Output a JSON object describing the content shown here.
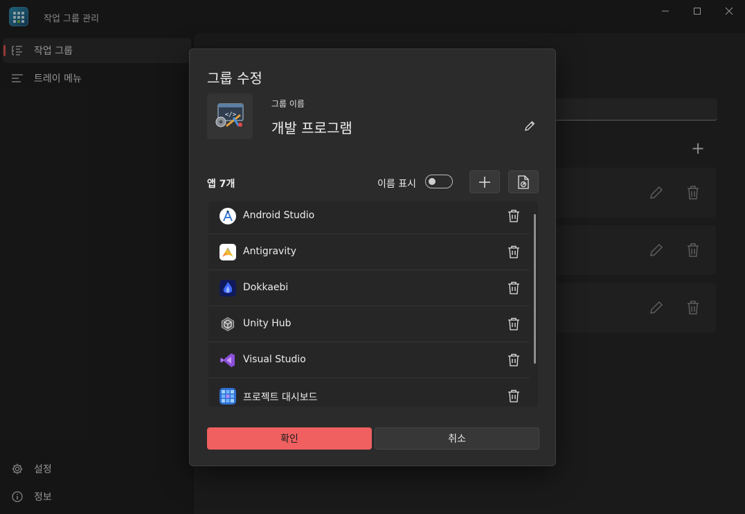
{
  "window": {
    "title": "작업 그룹 관리",
    "minimize_icon": "minimize-icon",
    "maximize_icon": "maximize-icon",
    "close_icon": "close-icon"
  },
  "sidebar": {
    "items": [
      {
        "label": "작업 그룹",
        "icon": "list-icon",
        "active": true
      },
      {
        "label": "트레이 메뉴",
        "icon": "menu-lines-icon",
        "active": false
      }
    ],
    "footer": [
      {
        "label": "설정",
        "icon": "gear-icon"
      },
      {
        "label": "정보",
        "icon": "info-icon"
      }
    ]
  },
  "dialog": {
    "title": "그룹 수정",
    "group_name_label": "그룹 이름",
    "group_name": "개발 프로그램",
    "apps_count": "앱 7개",
    "show_name_label": "이름 표시",
    "show_name_on": false,
    "apps": [
      {
        "name": "Android Studio",
        "icon": "android-studio-icon"
      },
      {
        "name": "Antigravity",
        "icon": "antigravity-icon"
      },
      {
        "name": "Dokkaebi",
        "icon": "dokkaebi-icon"
      },
      {
        "name": "Unity Hub",
        "icon": "unity-hub-icon"
      },
      {
        "name": "Visual Studio",
        "icon": "visual-studio-icon"
      },
      {
        "name": "프로젝트 대시보드",
        "icon": "project-dashboard-icon"
      }
    ],
    "confirm_label": "확인",
    "cancel_label": "취소"
  },
  "colors": {
    "accent": "#f06060",
    "active_indicator": "#e05252",
    "dialog_bg": "#2b2b2b",
    "window_bg": "#202020"
  }
}
